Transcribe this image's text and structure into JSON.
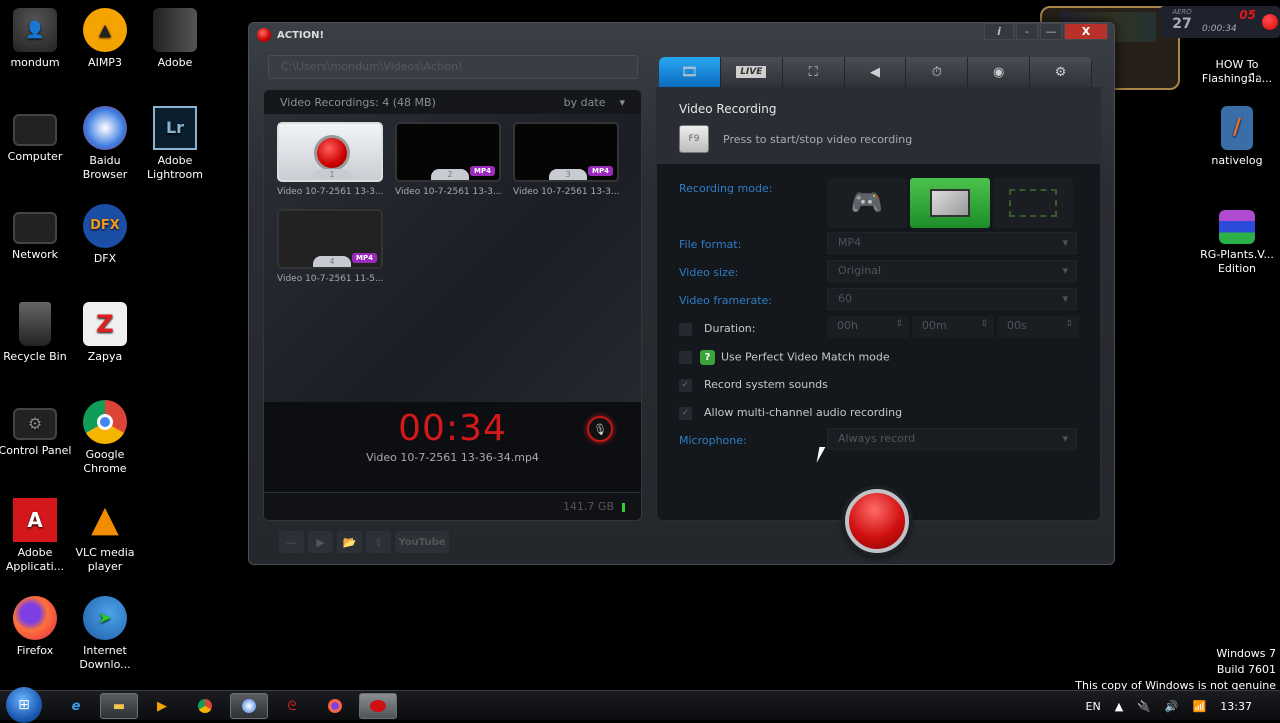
{
  "desktop": {
    "left_icons": [
      {
        "label": "mondum",
        "icon": "user-icon"
      },
      {
        "label": "AIMP3",
        "icon": "aimp-icon"
      },
      {
        "label": "Adobe",
        "icon": "folder-icon"
      },
      {
        "label": "Computer",
        "icon": "computer-icon"
      },
      {
        "label": "Baidu Browser",
        "icon": "baidu-icon"
      },
      {
        "label": "Adobe Lightroom",
        "icon": "lightroom-icon"
      },
      {
        "label": "Network",
        "icon": "network-icon"
      },
      {
        "label": "DFX",
        "icon": "dfx-icon"
      },
      {
        "label": "Recycle Bin",
        "icon": "recycle-bin-icon"
      },
      {
        "label": "Zapya",
        "icon": "zapya-icon"
      },
      {
        "label": "Control Panel",
        "icon": "control-panel-icon"
      },
      {
        "label": "Google Chrome",
        "icon": "chrome-icon"
      },
      {
        "label": "Adobe Applicati...",
        "icon": "adobe-icon"
      },
      {
        "label": "VLC media player",
        "icon": "vlc-icon"
      },
      {
        "label": "Firefox",
        "icon": "firefox-icon"
      },
      {
        "label": "Internet Downlo...",
        "icon": "idm-icon"
      }
    ],
    "right_icons": [
      {
        "label": "HOW To Flashingมือ...",
        "icon": "document-icon"
      },
      {
        "label": "nativelog",
        "icon": "notepad-icon"
      },
      {
        "label": "RG-Plants.V... Edition",
        "icon": "winrar-icon"
      }
    ],
    "watermark": [
      "Windows 7",
      "Build 7601",
      "This copy of Windows is not genuine"
    ]
  },
  "overlay": {
    "aero_label": "AERO",
    "aero_value": "27",
    "fps": "05",
    "elapsed": "0:00:34"
  },
  "window": {
    "title": "ACTION!",
    "controls": {
      "info": "i",
      "minimize_small": "-",
      "minimize": "—",
      "close": "X"
    },
    "path": "C:\\Users\\mondum\\Videos\\Action!",
    "recordings": {
      "header": "Video Recordings: 4 (48 MB)",
      "sort": "by date",
      "items": [
        {
          "number": "1",
          "caption": "Video 10-7-2561 13-3...",
          "badge": ""
        },
        {
          "number": "2",
          "caption": "Video 10-7-2561 13-3...",
          "badge": "MP4"
        },
        {
          "number": "3",
          "caption": "Video 10-7-2561 13-3...",
          "badge": "MP4"
        },
        {
          "number": "4",
          "caption": "Video 10-7-2561 11-5...",
          "badge": "MP4"
        }
      ]
    },
    "timer": "00:34",
    "current_file": "Video 10-7-2561 13-36-34.mp4",
    "free_space": "141.7 GB",
    "toolbar": {
      "delete": "—",
      "play": "▶",
      "folder": "📂",
      "upload": "⇧",
      "youtube": "YouTube"
    },
    "tabs": [
      {
        "name": "video-recording",
        "label": ""
      },
      {
        "name": "live",
        "label": "LIVE"
      },
      {
        "name": "game-benchmark",
        "label": ""
      },
      {
        "name": "audio",
        "label": ""
      },
      {
        "name": "timer",
        "label": ""
      },
      {
        "name": "screenshot",
        "label": ""
      },
      {
        "name": "settings",
        "label": ""
      }
    ],
    "settings": {
      "title": "Video Recording",
      "hotkey": "F9",
      "hotkey_hint": "Press to start/stop video recording",
      "recording_mode_label": "Recording mode:",
      "recording_modes": [
        "game",
        "desktop",
        "area"
      ],
      "recording_mode_selected": "desktop",
      "file_format_label": "File format:",
      "file_format": "MP4",
      "video_size_label": "Video size:",
      "video_size": "Original",
      "framerate_label": "Video framerate:",
      "framerate": "60",
      "duration_label": "Duration:",
      "duration_enabled": false,
      "duration": {
        "h": "00h",
        "m": "00m",
        "s": "00s"
      },
      "perfect_match_label": "Use Perfect Video Match mode",
      "perfect_match": false,
      "system_sounds_label": "Record system sounds",
      "system_sounds": true,
      "multichannel_label": "Allow multi-channel audio recording",
      "multichannel": true,
      "microphone_label": "Microphone:",
      "microphone": "Always record"
    }
  },
  "taskbar": {
    "apps": [
      "ie",
      "explorer",
      "media-player",
      "chrome",
      "baidu",
      "garena",
      "firefox",
      "action"
    ],
    "language": "EN",
    "clock": "13:37"
  }
}
